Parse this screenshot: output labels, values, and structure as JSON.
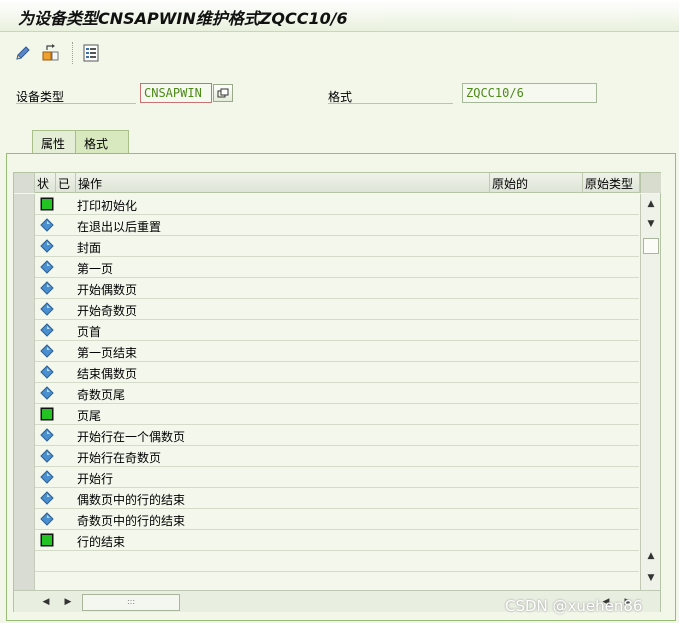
{
  "window": {
    "title": "为设备类型CNSAPWIN维护格式ZQCC10/6"
  },
  "toolbar": {
    "buttons": [
      {
        "icon": "pencil-icon"
      },
      {
        "icon": "display-change-icon"
      },
      {
        "icon": "list-icon"
      }
    ]
  },
  "header": {
    "device_type_label": "设备类型",
    "device_type_value": "CNSAPWIN",
    "format_label": "格式",
    "format_value": "ZQCC10/6"
  },
  "tabs": [
    {
      "label": "属性",
      "active": false
    },
    {
      "label": "格式",
      "active": true
    }
  ],
  "table": {
    "columns": [
      "状",
      "已",
      "操作",
      "原始的",
      "原始类型"
    ],
    "rows": [
      {
        "status": "green-square",
        "operation": "打印初始化"
      },
      {
        "status": "blue-diamond",
        "operation": "在退出以后重置"
      },
      {
        "status": "blue-diamond",
        "operation": "封面"
      },
      {
        "status": "blue-diamond",
        "operation": "第一页"
      },
      {
        "status": "blue-diamond",
        "operation": "开始偶数页"
      },
      {
        "status": "blue-diamond",
        "operation": "开始奇数页"
      },
      {
        "status": "blue-diamond",
        "operation": "页首"
      },
      {
        "status": "blue-diamond",
        "operation": "第一页结束"
      },
      {
        "status": "blue-diamond",
        "operation": "结束偶数页"
      },
      {
        "status": "blue-diamond",
        "operation": "奇数页尾"
      },
      {
        "status": "green-square",
        "operation": "页尾"
      },
      {
        "status": "blue-diamond",
        "operation": "开始行在一个偶数页"
      },
      {
        "status": "blue-diamond",
        "operation": "开始行在奇数页"
      },
      {
        "status": "blue-diamond",
        "operation": "开始行"
      },
      {
        "status": "blue-diamond",
        "operation": "偶数页中的行的结束"
      },
      {
        "status": "blue-diamond",
        "operation": "奇数页中的行的结束"
      },
      {
        "status": "green-square",
        "operation": "行的结束"
      },
      {
        "status": "",
        "operation": ""
      },
      {
        "status": "",
        "operation": ""
      }
    ]
  },
  "watermark": "CSDN @xuehen86",
  "colors": {
    "background": "#f2f7ea",
    "field_text": "#4d8a19",
    "status_green": "#22c322",
    "status_blue": "#4a8fd0"
  }
}
